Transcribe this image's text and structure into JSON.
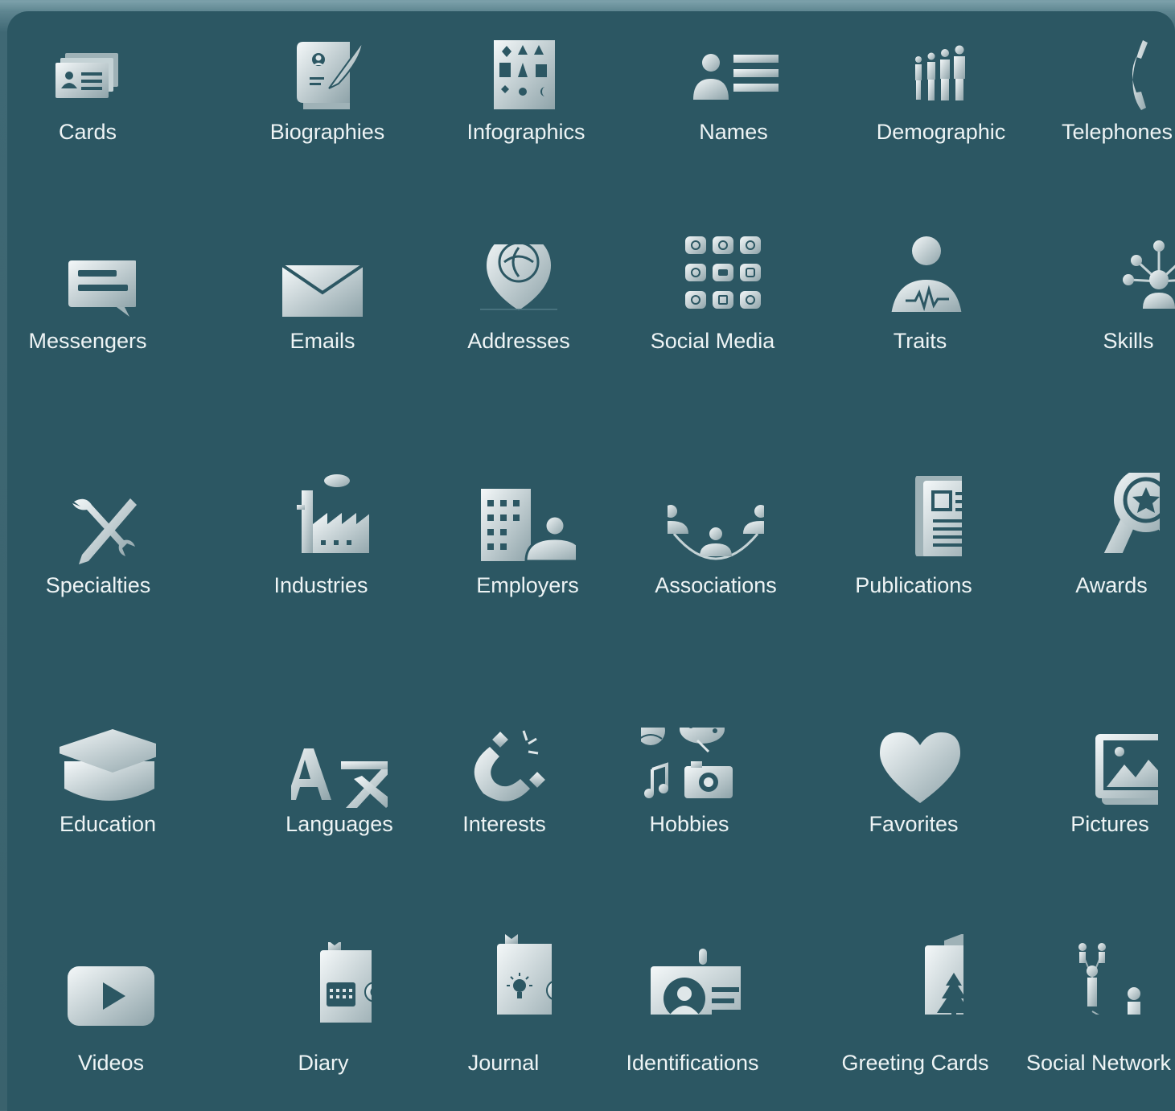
{
  "colors": {
    "panel": "#2c5763",
    "icon_light": "#f4f8f9",
    "icon_dark": "#8ea3a9",
    "label": "#eef4f5"
  },
  "items": [
    {
      "label": "Cards",
      "icon": "cards-icon"
    },
    {
      "label": "Biographies",
      "icon": "biographies-icon"
    },
    {
      "label": "Infographics",
      "icon": "infographics-icon"
    },
    {
      "label": "Names",
      "icon": "names-icon"
    },
    {
      "label": "Demographic",
      "icon": "demographic-icon"
    },
    {
      "label": "Telephones",
      "icon": "telephone-icon"
    },
    {
      "label": "Messengers",
      "icon": "messengers-icon"
    },
    {
      "label": "Emails",
      "icon": "email-icon"
    },
    {
      "label": "Addresses",
      "icon": "address-pin-icon"
    },
    {
      "label": "Social Media",
      "icon": "social-media-icon"
    },
    {
      "label": "Traits",
      "icon": "traits-icon"
    },
    {
      "label": "Skills",
      "icon": "skills-icon"
    },
    {
      "label": "Specialties",
      "icon": "specialties-icon"
    },
    {
      "label": "Industries",
      "icon": "factory-icon"
    },
    {
      "label": "Employers",
      "icon": "employers-icon"
    },
    {
      "label": "Associations",
      "icon": "associations-icon"
    },
    {
      "label": "Publications",
      "icon": "newspaper-icon"
    },
    {
      "label": "Awards",
      "icon": "award-ribbon-icon"
    },
    {
      "label": "Education",
      "icon": "graduation-cap-icon"
    },
    {
      "label": "Languages",
      "icon": "languages-icon"
    },
    {
      "label": "Interests",
      "icon": "magnet-icon"
    },
    {
      "label": "Hobbies",
      "icon": "hobbies-icon"
    },
    {
      "label": "Favorites",
      "icon": "heart-icon"
    },
    {
      "label": "Pictures",
      "icon": "pictures-icon"
    },
    {
      "label": "Videos",
      "icon": "play-video-icon"
    },
    {
      "label": "Diary",
      "icon": "diary-icon"
    },
    {
      "label": "Journal",
      "icon": "journal-icon"
    },
    {
      "label": "Identifications",
      "icon": "id-badge-icon"
    },
    {
      "label": "Greeting Cards",
      "icon": "greeting-card-icon"
    },
    {
      "label": "Social Network",
      "icon": "social-network-icon"
    }
  ]
}
